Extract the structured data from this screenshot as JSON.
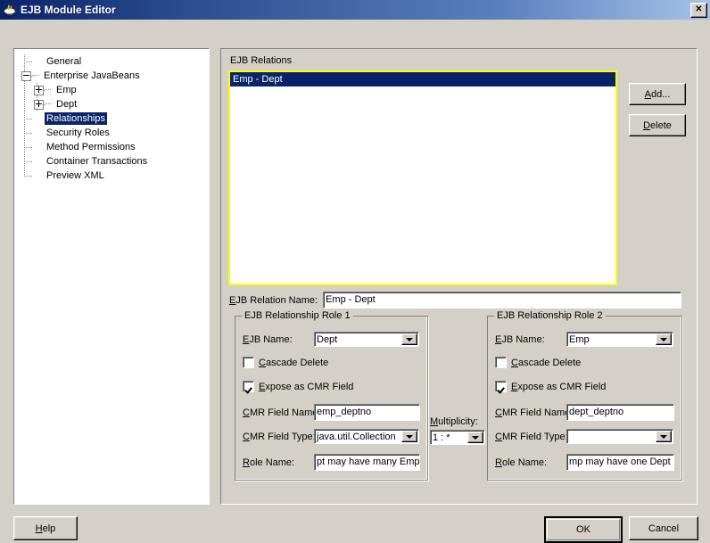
{
  "window": {
    "title": "EJB Module Editor",
    "icon": "java-bean-icon",
    "close_label": "✕"
  },
  "tree": {
    "nodes": [
      {
        "label": "General",
        "depth": 1,
        "toggle": "none",
        "selected": false
      },
      {
        "label": "Enterprise JavaBeans",
        "depth": 1,
        "toggle": "minus",
        "selected": false
      },
      {
        "label": "Emp",
        "depth": 2,
        "toggle": "plus",
        "selected": false
      },
      {
        "label": "Dept",
        "depth": 2,
        "toggle": "plus",
        "selected": false
      },
      {
        "label": "Relationships",
        "depth": 1,
        "toggle": "none",
        "selected": true
      },
      {
        "label": "Security Roles",
        "depth": 1,
        "toggle": "none",
        "selected": false
      },
      {
        "label": "Method Permissions",
        "depth": 1,
        "toggle": "none",
        "selected": false
      },
      {
        "label": "Container Transactions",
        "depth": 1,
        "toggle": "none",
        "selected": false
      },
      {
        "label": "Preview XML",
        "depth": 1,
        "toggle": "none",
        "selected": false
      }
    ]
  },
  "relations": {
    "label": "EJB Relations",
    "items": [
      "Emp - Dept"
    ],
    "selected_index": 0,
    "add_label": "Add...",
    "add_mnemonic": "A",
    "delete_label": "Delete",
    "delete_mnemonic": "D"
  },
  "relation_form": {
    "name_label": "EJB Relation Name:",
    "name_mnemonic": "E",
    "name_value": "Emp - Dept",
    "multiplicity_label": "Multiplicity:",
    "multiplicity_mnemonic": "M",
    "multiplicity_value": "1 : *",
    "role1": {
      "title": "EJB Relationship Role 1",
      "ejb_name_label": "EJB Name:",
      "ejb_name_value": "Dept",
      "cascade_label": "Cascade Delete",
      "cascade_checked": false,
      "expose_label": "Expose as CMR Field",
      "expose_checked": true,
      "cmr_field_name_label": "CMR Field Name:",
      "cmr_field_name_value": "emp_deptno",
      "cmr_field_type_label": "CMR Field Type:",
      "cmr_field_type_value": "java.util.Collection",
      "role_name_label": "Role Name:",
      "role_name_value": "pt may have many Emp"
    },
    "role2": {
      "title": "EJB Relationship Role 2",
      "ejb_name_label": "EJB Name:",
      "ejb_name_value": "Emp",
      "cascade_label": "Cascade Delete",
      "cascade_checked": false,
      "expose_label": "Expose as CMR Field",
      "expose_checked": true,
      "cmr_field_name_label": "CMR Field Name:",
      "cmr_field_name_value": "dept_deptno",
      "cmr_field_type_label": "CMR Field Type:",
      "cmr_field_type_value": "",
      "role_name_label": "Role Name:",
      "role_name_value": "mp may have one Dept"
    }
  },
  "footer": {
    "help_label": "Help",
    "ok_label": "OK",
    "cancel_label": "Cancel"
  },
  "colors": {
    "dialog_face": "#d4d0c8",
    "selection": "#0a246a",
    "focus_outline": "#ffff00",
    "title_gradient_start": "#0a246a",
    "title_gradient_end": "#a6c2e8"
  }
}
